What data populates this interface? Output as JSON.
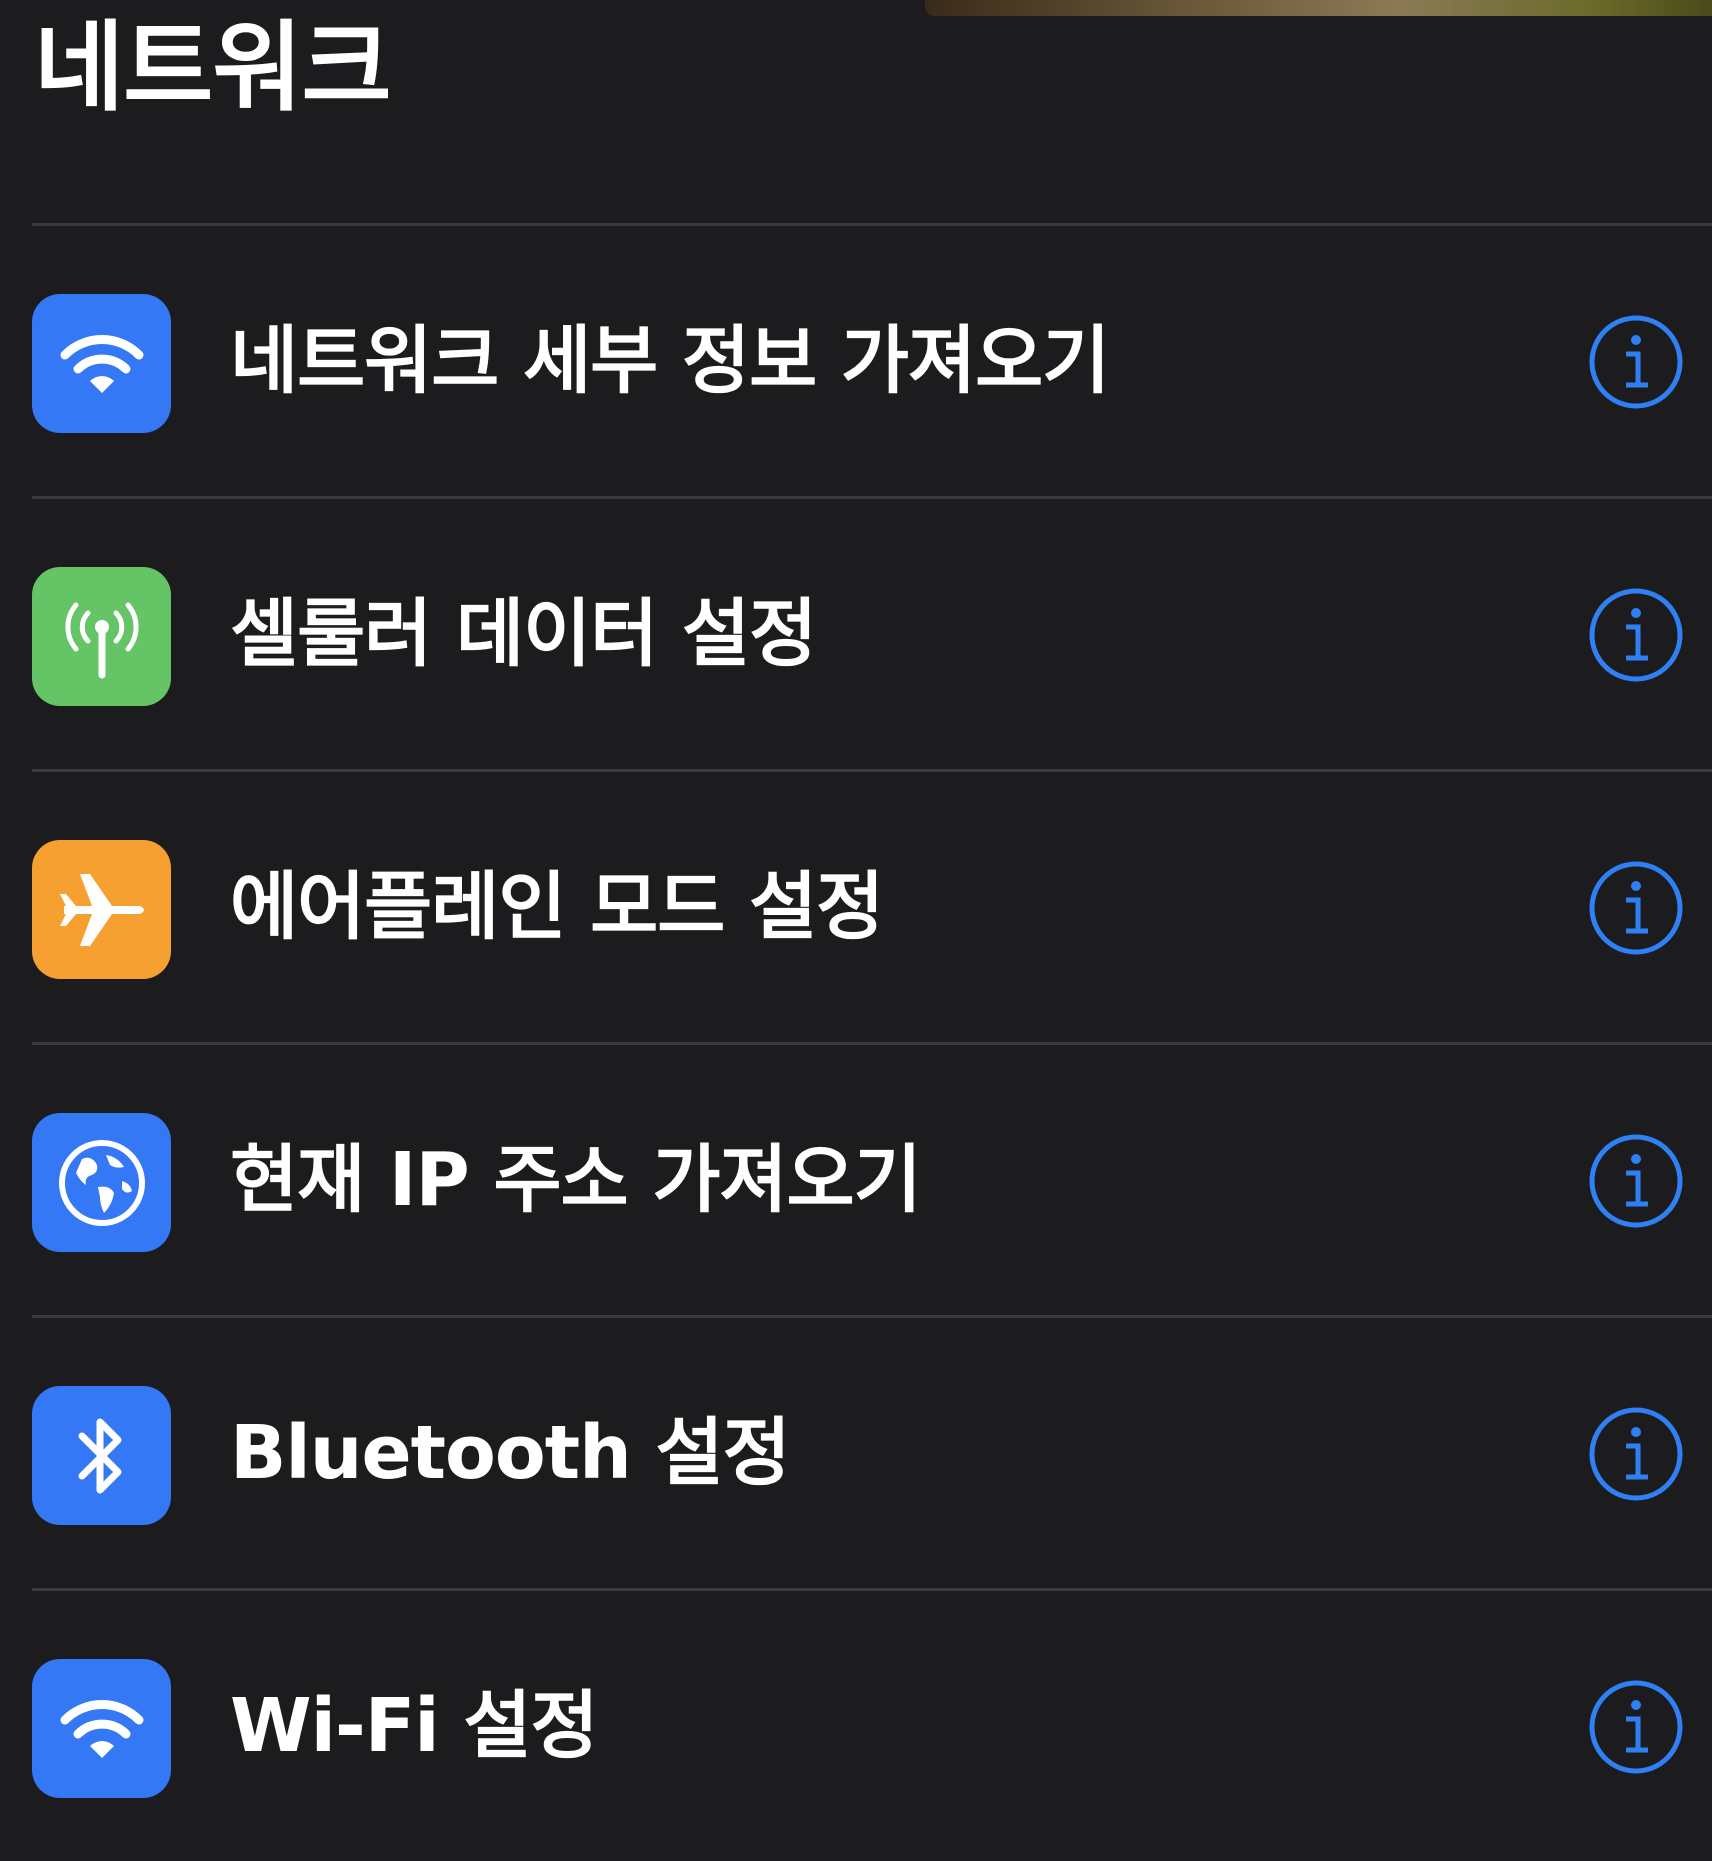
{
  "page": {
    "title": "네트워크"
  },
  "colors": {
    "background": "#1c1c1e",
    "separator": "#3a3a3c",
    "info_blue": "#2f80f5"
  },
  "items": [
    {
      "label": "네트워크 세부 정보 가져오기",
      "icon": "wifi-icon",
      "icon_bg": "#3478f6"
    },
    {
      "label": "셀룰러 데이터 설정",
      "icon": "antenna-icon",
      "icon_bg": "#65c466"
    },
    {
      "label": "에어플레인 모드 설정",
      "icon": "airplane-icon",
      "icon_bg": "#f5a031"
    },
    {
      "label": "현재 IP 주소 가져오기",
      "icon": "globe-icon",
      "icon_bg": "#3478f6"
    },
    {
      "label": "Bluetooth 설정",
      "icon": "bluetooth-icon",
      "icon_bg": "#3478f6"
    },
    {
      "label": "Wi-Fi 설정",
      "icon": "wifi-icon",
      "icon_bg": "#3478f6"
    }
  ]
}
